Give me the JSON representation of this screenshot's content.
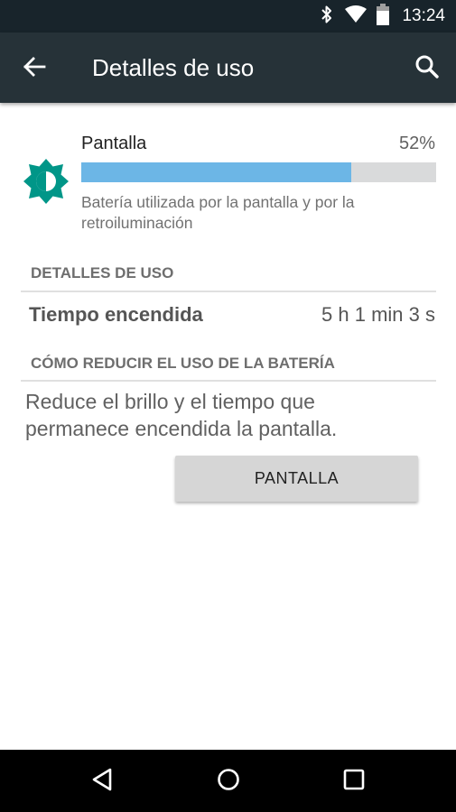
{
  "status_bar": {
    "time": "13:24",
    "icons": [
      "bluetooth-icon",
      "wifi-icon",
      "battery-icon"
    ]
  },
  "app_bar": {
    "title": "Detalles de uso",
    "back_icon": "arrow-back-icon",
    "search_icon": "search-icon",
    "background_color": "#263238"
  },
  "usage_item": {
    "icon": "brightness-icon",
    "icon_color": "#009688",
    "name": "Pantalla",
    "percent_label": "52%",
    "percent_value": 0.52,
    "bar_fill_fraction": 0.76,
    "bar_color": "#6cb6e6",
    "description": "Batería utilizada por la pantalla y por la retroiluminación"
  },
  "usage_details": {
    "header": "DETALLES DE USO",
    "rows": [
      {
        "label": "Tiempo encendida",
        "value": "5 h 1 min 3 s"
      }
    ]
  },
  "reduce_section": {
    "header": "CÓMO REDUCIR EL USO DE LA BATERÍA",
    "tip": "Reduce el brillo y el tiempo que permanece encendida la pantalla.",
    "button_label": "PANTALLA"
  },
  "nav_bar": {
    "buttons": [
      "back-triangle-icon",
      "home-circle-icon",
      "recents-square-icon"
    ]
  }
}
